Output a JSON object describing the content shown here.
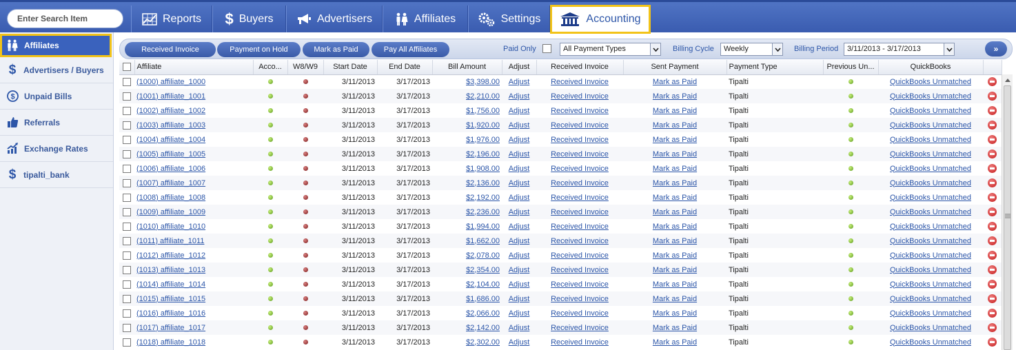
{
  "search": {
    "placeholder": "Enter Search Item"
  },
  "nav": {
    "tabs": [
      {
        "label": "Reports",
        "icon": "chart-icon"
      },
      {
        "label": "Buyers",
        "icon": "dollar-icon"
      },
      {
        "label": "Advertisers",
        "icon": "megaphone-icon"
      },
      {
        "label": "Affiliates",
        "icon": "people-icon"
      },
      {
        "label": "Settings",
        "icon": "gears-icon"
      },
      {
        "label": "Accounting",
        "icon": "bank-icon",
        "active": true
      }
    ]
  },
  "sidebar": {
    "items": [
      {
        "label": "Affiliates",
        "icon": "people-icon",
        "active": true
      },
      {
        "label": "Advertisers / Buyers",
        "icon": "dollar-icon"
      },
      {
        "label": "Unpaid Bills",
        "icon": "coin-icon"
      },
      {
        "label": "Referrals",
        "icon": "thumbs-up-icon"
      },
      {
        "label": "Exchange Rates",
        "icon": "trend-icon"
      },
      {
        "label": "tipalti_bank",
        "icon": "dollar-icon"
      }
    ]
  },
  "toolbar": {
    "received_invoice": "Received Invoice",
    "payment_on_hold": "Payment on Hold",
    "mark_as_paid": "Mark as Paid",
    "pay_all": "Pay All Affiliates",
    "paid_only_label": "Paid Only",
    "payment_types": "All Payment Types",
    "billing_cycle_label": "Billing Cycle",
    "billing_cycle": "Weekly",
    "billing_period_label": "Billing Period",
    "billing_period": "3/11/2013 - 3/17/2013",
    "go": "»"
  },
  "table": {
    "headers": {
      "affiliate": "Affiliate",
      "account": "Acco...",
      "w8w9": "W8/W9",
      "start_date": "Start Date",
      "end_date": "End Date",
      "bill_amount": "Bill Amount",
      "adjust": "Adjust",
      "received_invoice": "Received Invoice",
      "sent_payment": "Sent Payment",
      "payment_type": "Payment Type",
      "previous_unpaid": "Previous Un...",
      "quickbooks": "QuickBooks"
    },
    "rows": [
      {
        "affiliate": "(1000) affiliate_1000",
        "start": "3/11/2013",
        "end": "3/17/2013",
        "amount": "$3,398.00",
        "adjust": "Adjust",
        "received": "Received Invoice",
        "sent": "Mark as Paid",
        "ptype": "Tipalti",
        "qb": "QuickBooks Unmatched"
      },
      {
        "affiliate": "(1001) affiliate_1001",
        "start": "3/11/2013",
        "end": "3/17/2013",
        "amount": "$2,210.00",
        "adjust": "Adjust",
        "received": "Received Invoice",
        "sent": "Mark as Paid",
        "ptype": "Tipalti",
        "qb": "QuickBooks Unmatched"
      },
      {
        "affiliate": "(1002) affiliate_1002",
        "start": "3/11/2013",
        "end": "3/17/2013",
        "amount": "$1,756.00",
        "adjust": "Adjust",
        "received": "Received Invoice",
        "sent": "Mark as Paid",
        "ptype": "Tipalti",
        "qb": "QuickBooks Unmatched"
      },
      {
        "affiliate": "(1003) affiliate_1003",
        "start": "3/11/2013",
        "end": "3/17/2013",
        "amount": "$1,920.00",
        "adjust": "Adjust",
        "received": "Received Invoice",
        "sent": "Mark as Paid",
        "ptype": "Tipalti",
        "qb": "QuickBooks Unmatched"
      },
      {
        "affiliate": "(1004) affiliate_1004",
        "start": "3/11/2013",
        "end": "3/17/2013",
        "amount": "$1,976.00",
        "adjust": "Adjust",
        "received": "Received Invoice",
        "sent": "Mark as Paid",
        "ptype": "Tipalti",
        "qb": "QuickBooks Unmatched"
      },
      {
        "affiliate": "(1005) affiliate_1005",
        "start": "3/11/2013",
        "end": "3/17/2013",
        "amount": "$2,196.00",
        "adjust": "Adjust",
        "received": "Received Invoice",
        "sent": "Mark as Paid",
        "ptype": "Tipalti",
        "qb": "QuickBooks Unmatched"
      },
      {
        "affiliate": "(1006) affiliate_1006",
        "start": "3/11/2013",
        "end": "3/17/2013",
        "amount": "$1,908.00",
        "adjust": "Adjust",
        "received": "Received Invoice",
        "sent": "Mark as Paid",
        "ptype": "Tipalti",
        "qb": "QuickBooks Unmatched"
      },
      {
        "affiliate": "(1007) affiliate_1007",
        "start": "3/11/2013",
        "end": "3/17/2013",
        "amount": "$2,136.00",
        "adjust": "Adjust",
        "received": "Received Invoice",
        "sent": "Mark as Paid",
        "ptype": "Tipalti",
        "qb": "QuickBooks Unmatched"
      },
      {
        "affiliate": "(1008) affiliate_1008",
        "start": "3/11/2013",
        "end": "3/17/2013",
        "amount": "$2,192.00",
        "adjust": "Adjust",
        "received": "Received Invoice",
        "sent": "Mark as Paid",
        "ptype": "Tipalti",
        "qb": "QuickBooks Unmatched"
      },
      {
        "affiliate": "(1009) affiliate_1009",
        "start": "3/11/2013",
        "end": "3/17/2013",
        "amount": "$2,236.00",
        "adjust": "Adjust",
        "received": "Received Invoice",
        "sent": "Mark as Paid",
        "ptype": "Tipalti",
        "qb": "QuickBooks Unmatched"
      },
      {
        "affiliate": "(1010) affiliate_1010",
        "start": "3/11/2013",
        "end": "3/17/2013",
        "amount": "$1,994.00",
        "adjust": "Adjust",
        "received": "Received Invoice",
        "sent": "Mark as Paid",
        "ptype": "Tipalti",
        "qb": "QuickBooks Unmatched"
      },
      {
        "affiliate": "(1011) affiliate_1011",
        "start": "3/11/2013",
        "end": "3/17/2013",
        "amount": "$1,662.00",
        "adjust": "Adjust",
        "received": "Received Invoice",
        "sent": "Mark as Paid",
        "ptype": "Tipalti",
        "qb": "QuickBooks Unmatched"
      },
      {
        "affiliate": "(1012) affiliate_1012",
        "start": "3/11/2013",
        "end": "3/17/2013",
        "amount": "$2,078.00",
        "adjust": "Adjust",
        "received": "Received Invoice",
        "sent": "Mark as Paid",
        "ptype": "Tipalti",
        "qb": "QuickBooks Unmatched"
      },
      {
        "affiliate": "(1013) affiliate_1013",
        "start": "3/11/2013",
        "end": "3/17/2013",
        "amount": "$2,354.00",
        "adjust": "Adjust",
        "received": "Received Invoice",
        "sent": "Mark as Paid",
        "ptype": "Tipalti",
        "qb": "QuickBooks Unmatched"
      },
      {
        "affiliate": "(1014) affiliate_1014",
        "start": "3/11/2013",
        "end": "3/17/2013",
        "amount": "$2,104.00",
        "adjust": "Adjust",
        "received": "Received Invoice",
        "sent": "Mark as Paid",
        "ptype": "Tipalti",
        "qb": "QuickBooks Unmatched"
      },
      {
        "affiliate": "(1015) affiliate_1015",
        "start": "3/11/2013",
        "end": "3/17/2013",
        "amount": "$1,686.00",
        "adjust": "Adjust",
        "received": "Received Invoice",
        "sent": "Mark as Paid",
        "ptype": "Tipalti",
        "qb": "QuickBooks Unmatched"
      },
      {
        "affiliate": "(1016) affiliate_1016",
        "start": "3/11/2013",
        "end": "3/17/2013",
        "amount": "$2,066.00",
        "adjust": "Adjust",
        "received": "Received Invoice",
        "sent": "Mark as Paid",
        "ptype": "Tipalti",
        "qb": "QuickBooks Unmatched"
      },
      {
        "affiliate": "(1017) affiliate_1017",
        "start": "3/11/2013",
        "end": "3/17/2013",
        "amount": "$2,142.00",
        "adjust": "Adjust",
        "received": "Received Invoice",
        "sent": "Mark as Paid",
        "ptype": "Tipalti",
        "qb": "QuickBooks Unmatched"
      },
      {
        "affiliate": "(1018) affiliate_1018",
        "start": "3/11/2013",
        "end": "3/17/2013",
        "amount": "$2,302.00",
        "adjust": "Adjust",
        "received": "Received Invoice",
        "sent": "Mark as Paid",
        "ptype": "Tipalti",
        "qb": "QuickBooks Unmatched"
      }
    ]
  }
}
